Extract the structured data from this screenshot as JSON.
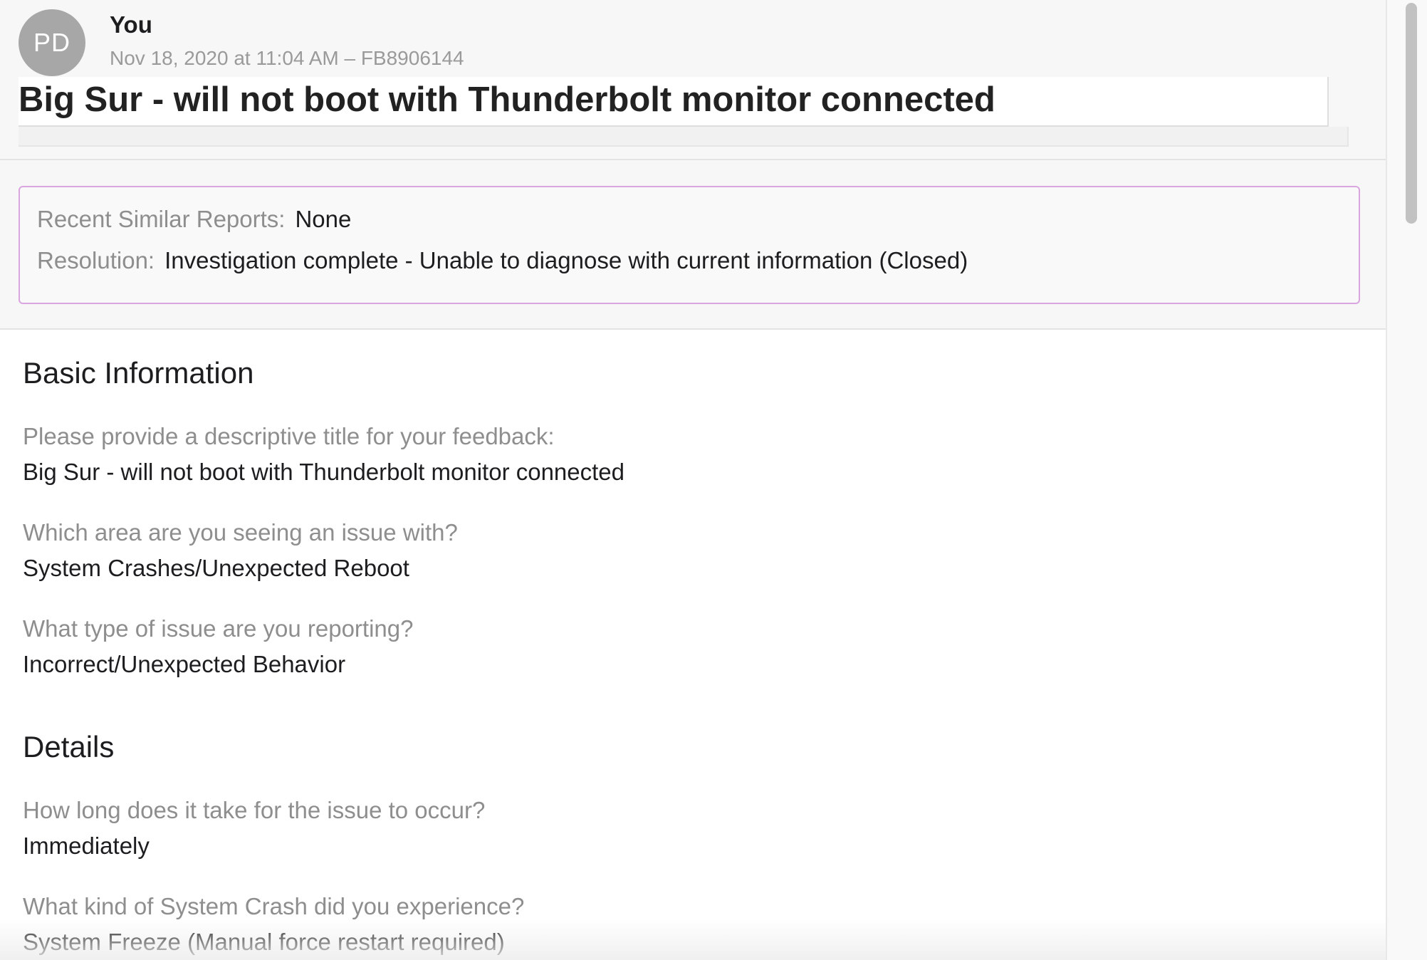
{
  "message": {
    "avatar_initials": "PD",
    "sender": "You",
    "meta": "Nov 18, 2020 at 11:04 AM – FB8906144",
    "subject": "Big Sur - will not boot with Thunderbolt monitor connected"
  },
  "status": {
    "similar_label": "Recent Similar Reports:",
    "similar_value": "None",
    "resolution_label": "Resolution:",
    "resolution_value": "Investigation complete - Unable to diagnose with current information (Closed)"
  },
  "basic_info": {
    "title": "Basic Information",
    "items": [
      {
        "question": "Please provide a descriptive title for your feedback:",
        "answer": "Big Sur - will not boot with Thunderbolt monitor connected"
      },
      {
        "question": "Which area are you seeing an issue with?",
        "answer": "System Crashes/Unexpected Reboot"
      },
      {
        "question": "What type of issue are you reporting?",
        "answer": "Incorrect/Unexpected Behavior"
      }
    ]
  },
  "details": {
    "title": "Details",
    "items": [
      {
        "question": "How long does it take for the issue to occur?",
        "answer": "Immediately"
      },
      {
        "question": "What kind of System Crash did you experience?",
        "answer": "System Freeze (Manual force restart required)"
      }
    ]
  }
}
